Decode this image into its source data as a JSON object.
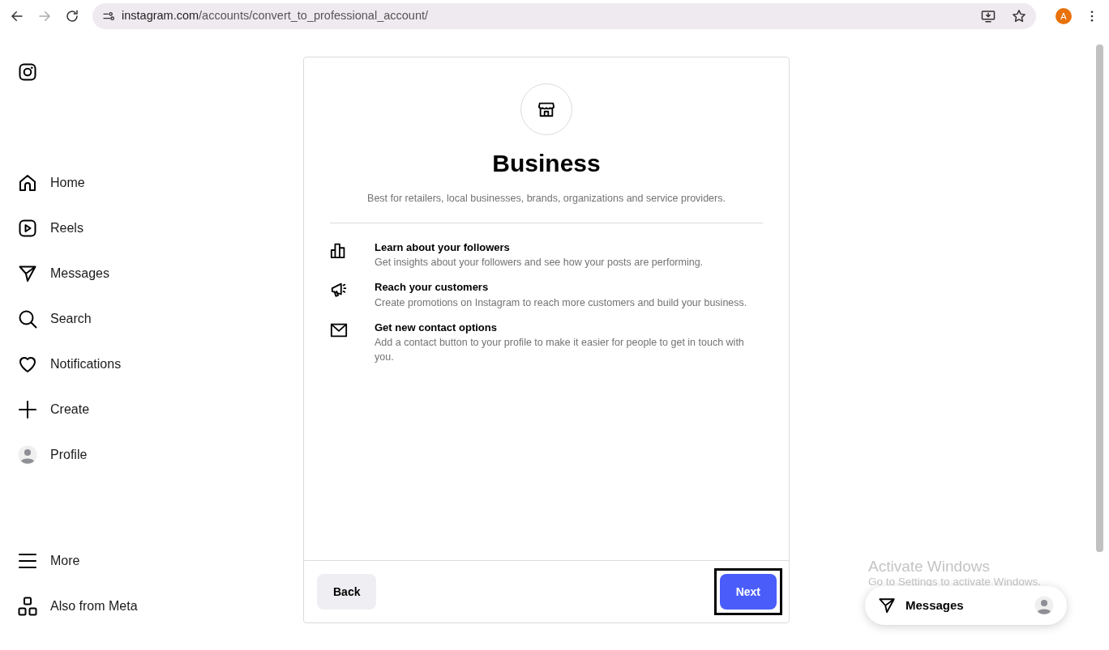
{
  "browser": {
    "url_host": "instagram.com",
    "url_path": "/accounts/convert_to_professional_account/",
    "profile_initial": "A"
  },
  "sidebar": {
    "items": [
      {
        "label": "Home",
        "kind": "home"
      },
      {
        "label": "Reels",
        "kind": "reels"
      },
      {
        "label": "Messages",
        "kind": "messages"
      },
      {
        "label": "Search",
        "kind": "search"
      },
      {
        "label": "Notifications",
        "kind": "heart"
      },
      {
        "label": "Create",
        "kind": "plus"
      },
      {
        "label": "Profile",
        "kind": "avatar"
      }
    ],
    "bottom_items": [
      {
        "label": "More",
        "kind": "menu"
      },
      {
        "label": "Also from Meta",
        "kind": "meta"
      }
    ]
  },
  "card": {
    "title": "Business",
    "subtitle": "Best for retailers, local businesses, brands, organizations and service providers.",
    "features": [
      {
        "kind": "chart",
        "title": "Learn about your followers",
        "text": "Get insights about your followers and see how your posts are performing."
      },
      {
        "kind": "megaphone",
        "title": "Reach your customers",
        "text": "Create promotions on Instagram to reach more customers and build your business."
      },
      {
        "kind": "mail",
        "title": "Get new contact options",
        "text": "Add a contact button to your profile to make it easier for people to get in touch with you."
      }
    ],
    "back_button": "Back",
    "next_button": {
      "label": "Next",
      "focused": true
    }
  },
  "activation_notice": {
    "title": "Activate Windows",
    "text": "Go to Settings to activate Windows."
  },
  "messages_bar": {
    "label": "Messages"
  }
}
